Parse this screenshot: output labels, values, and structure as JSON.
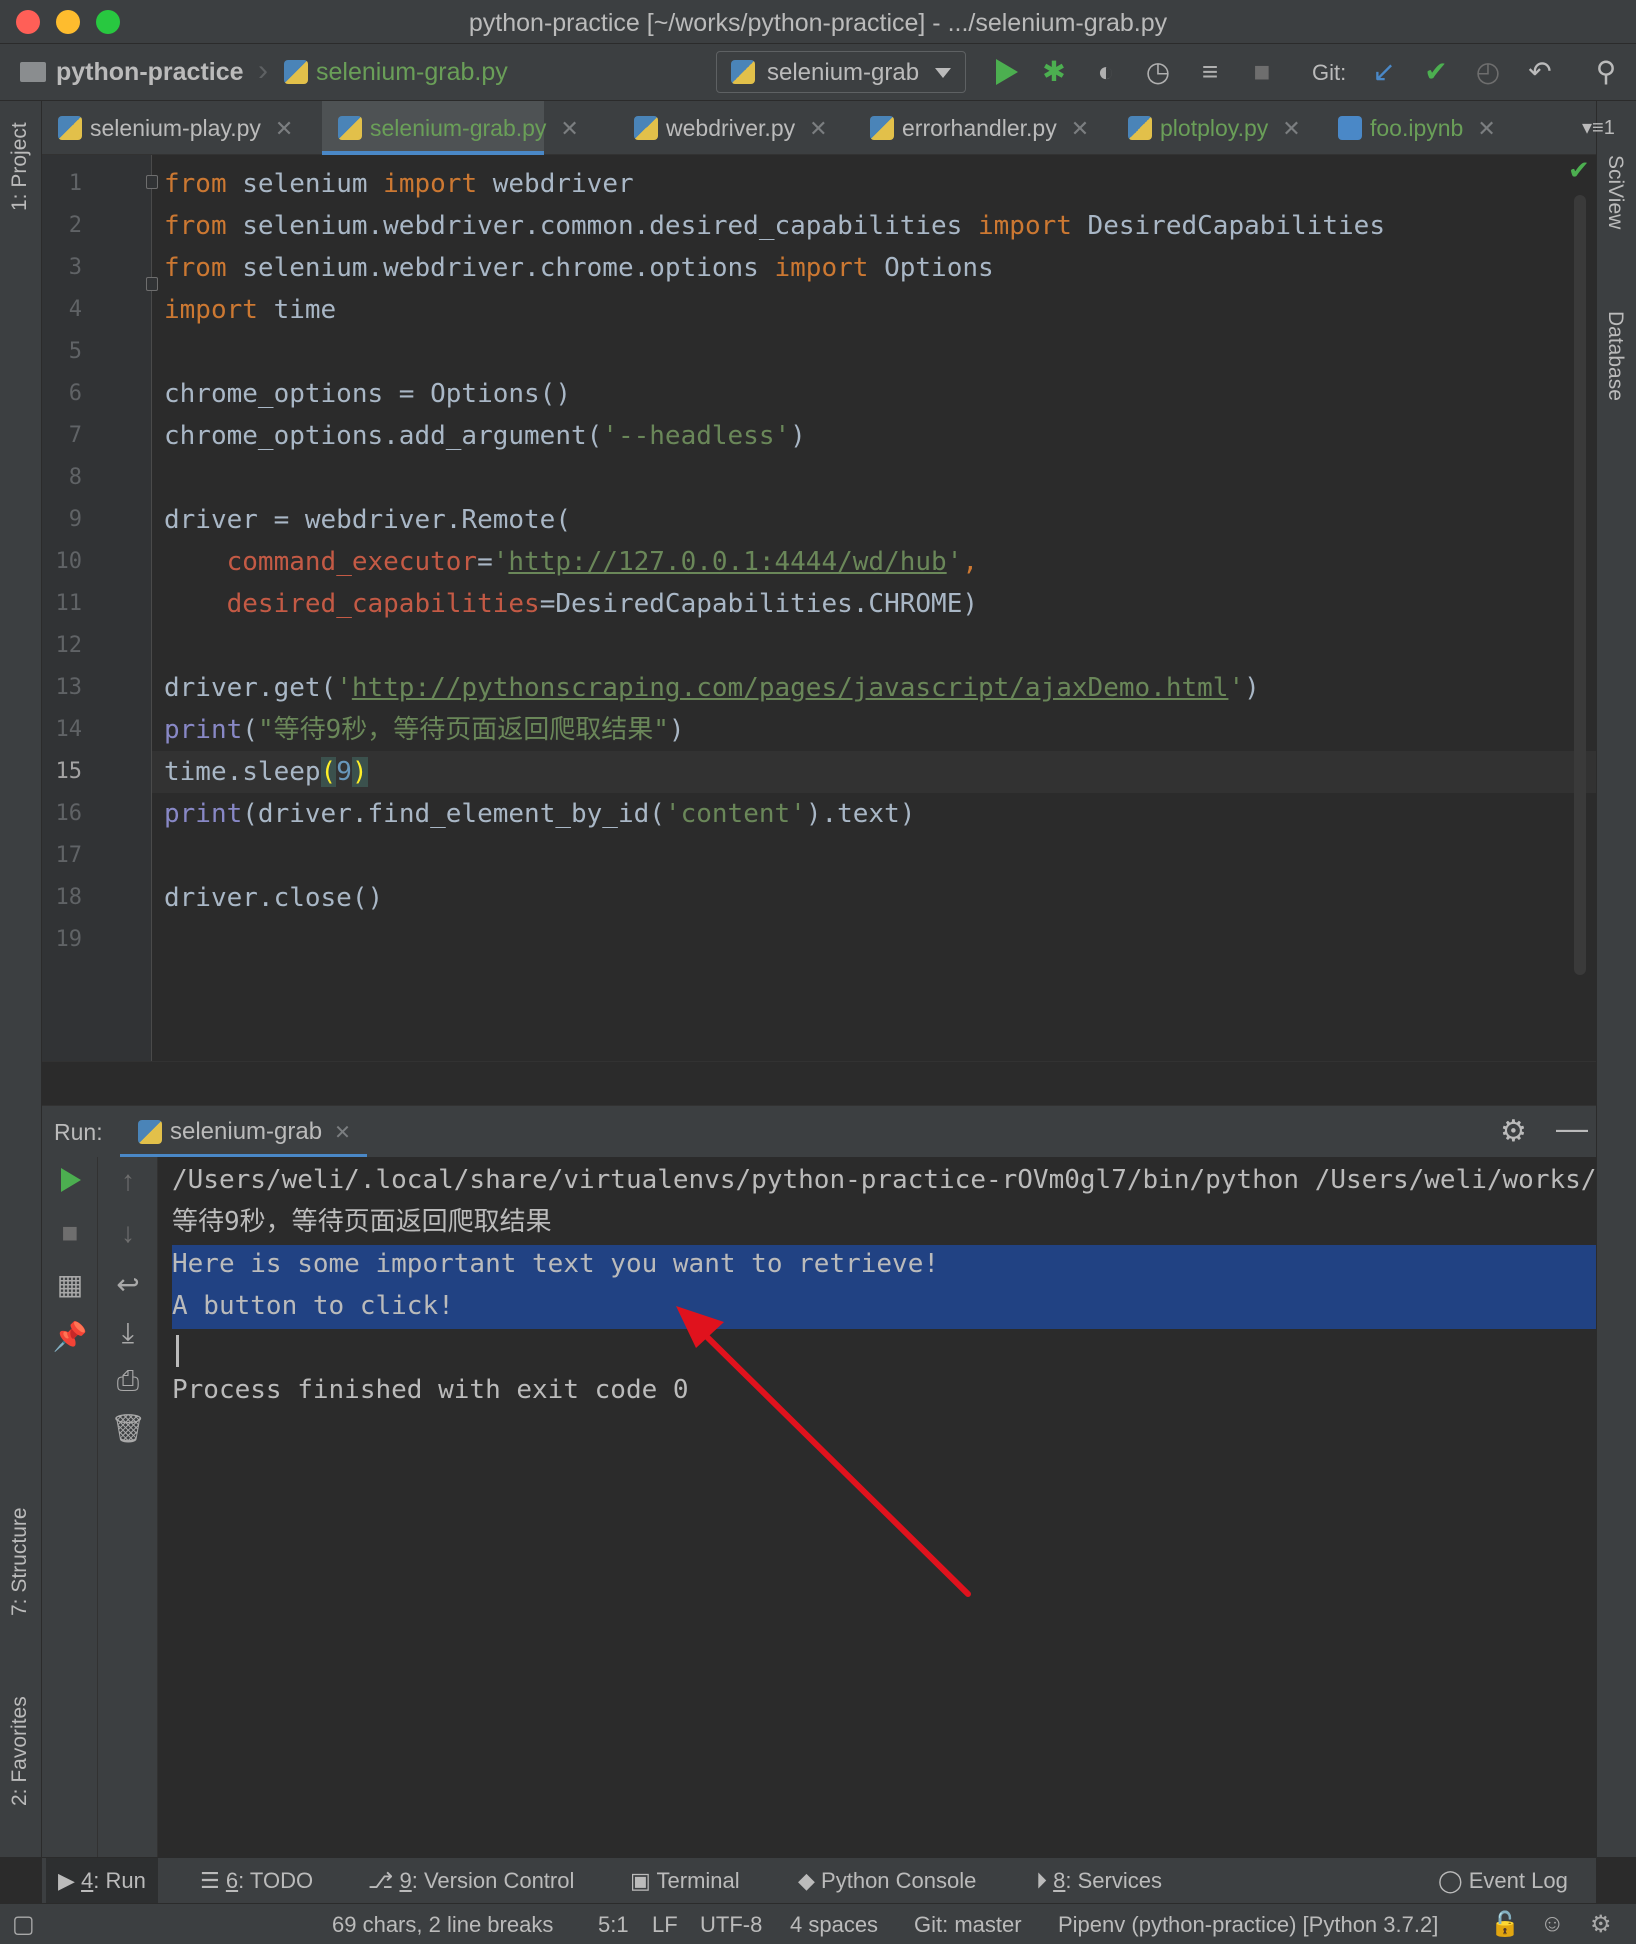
{
  "window": {
    "title": "python-practice [~/works/python-practice] - .../selenium-grab.py"
  },
  "navbar": {
    "project": "python-practice",
    "file": "selenium-grab.py",
    "run_config": "selenium-grab",
    "git_label": "Git:"
  },
  "left_strip": {
    "project": "1: Project",
    "structure": "7: Structure",
    "favorites": "2: Favorites"
  },
  "right_strip": {
    "sciview": "SciView",
    "database": "Database"
  },
  "tabs": [
    {
      "label": "selenium-play.py",
      "active": false
    },
    {
      "label": "selenium-grab.py",
      "active": true
    },
    {
      "label": "webdriver.py",
      "active": false
    },
    {
      "label": "errorhandler.py",
      "active": false
    },
    {
      "label": "plotploy.py",
      "active": false
    },
    {
      "label": "foo.ipynb",
      "active": false
    }
  ],
  "tab_overflow": "1",
  "editor": {
    "current_line": 15,
    "line_numbers": [
      "1",
      "2",
      "3",
      "4",
      "5",
      "6",
      "7",
      "8",
      "9",
      "10",
      "11",
      "12",
      "13",
      "14",
      "15",
      "16",
      "17",
      "18",
      "19"
    ],
    "code": {
      "l1": {
        "kw1": "from",
        "t1": " selenium ",
        "kw2": "import",
        "t2": " webdriver"
      },
      "l2": {
        "kw1": "from",
        "t1": " selenium.webdriver.common.desired_capabilities ",
        "kw2": "import",
        "t2": " DesiredCapabilities"
      },
      "l3": {
        "kw1": "from",
        "t1": " selenium.webdriver.chrome.options ",
        "kw2": "import",
        "t2": " Options"
      },
      "l4": {
        "kw1": "import",
        "t1": " time"
      },
      "l6": {
        "t1": "chrome_options = Options()"
      },
      "l7": {
        "t1": "chrome_options.add_argument(",
        "s1": "'--headless'",
        "t2": ")"
      },
      "l9": {
        "t1": "driver = webdriver.Remote("
      },
      "l10": {
        "indent": "    ",
        "p1": "command_executor",
        "t1": "=",
        "q1": "'",
        "u1": "http://127.0.0.1:4444/wd/hub",
        "q2": "'",
        "t2": ","
      },
      "l11": {
        "indent": "    ",
        "p1": "desired_capabilities",
        "t1": "=DesiredCapabilities.CHROME)"
      },
      "l13": {
        "t1": "driver.get(",
        "q1": "'",
        "u1": "http://pythonscraping.com/pages/javascript/ajaxDemo.html",
        "q2": "'",
        "t2": ")"
      },
      "l14": {
        "b1": "print",
        "t1": "(",
        "s1": "\"等待9秒，等待页面返回爬取结果\"",
        "t2": ")"
      },
      "l15": {
        "t1": "time.sleep",
        "m1": "(",
        "n1": "9",
        "m2": ")"
      },
      "l16": {
        "b1": "print",
        "t1": "(driver.find_element_by_id(",
        "s1": "'content'",
        "t2": ").text)"
      },
      "l18": {
        "t1": "driver.close()"
      }
    }
  },
  "run_panel": {
    "label": "Run:",
    "tab": "selenium-grab",
    "console": [
      "/Users/weli/.local/share/virtualenvs/python-practice-rOVm0gl7/bin/python /Users/weli/works/python-practice/selenium-grab.py",
      "等待9秒，等待页面返回爬取结果",
      "Here is some important text you want to retrieve!",
      "A button to click!",
      "",
      "Process finished with exit code 0"
    ]
  },
  "tool_windows": {
    "run": {
      "key": "4",
      "label": ": Run"
    },
    "todo": {
      "key": "6",
      "label": ": TODO"
    },
    "vcs": {
      "key": "9",
      "label": ": Version Control"
    },
    "terminal": "Terminal",
    "python_console": "Python Console",
    "services": {
      "key": "8",
      "label": ": Services"
    },
    "event_log": "Event Log"
  },
  "status": {
    "selection": "69 chars, 2 line breaks",
    "position": "5:1",
    "line_sep": "LF",
    "encoding": "UTF-8",
    "indent": "4 spaces",
    "git": "Git: master",
    "interpreter": "Pipenv (python-practice) [Python 3.7.2]"
  },
  "colors": {
    "accent": "#4a88c7",
    "selection": "#214283",
    "annotation_arrow": "#e0121d",
    "run_green": "#4caf50"
  }
}
